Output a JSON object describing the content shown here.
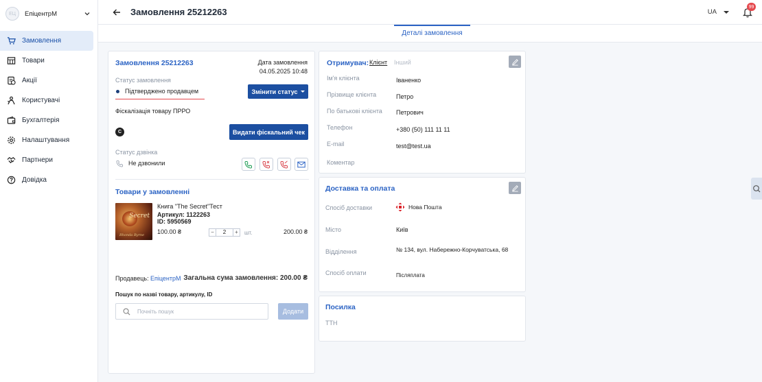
{
  "sidebar": {
    "logo_text": "ЕЦ",
    "company": "ЕпіцентрМ",
    "items": [
      {
        "label": "Замовлення",
        "active": true
      },
      {
        "label": "Товари"
      },
      {
        "label": "Акції"
      },
      {
        "label": "Користувачі"
      },
      {
        "label": "Бухгалтерія"
      },
      {
        "label": "Налаштування"
      },
      {
        "label": "Партнери"
      },
      {
        "label": "Довідка"
      }
    ]
  },
  "header": {
    "title": "Замовлення 25212263",
    "lang": "UA",
    "notifications": "99"
  },
  "tabs": [
    {
      "label": "Деталі замовлення",
      "active": true
    }
  ],
  "order": {
    "title": "Замовлення 25212263",
    "date_label": "Дата замовлення",
    "date_value": "04.05.2025 10:48",
    "status_label": "Статус замовлення",
    "status_value": "Підтверджено продавцем",
    "change_status": "Змінити статус",
    "fiscal_label": "Фіскалізація товару ПРРО",
    "fiscal_badge": "C",
    "fiscal_button": "Видати фіскальний чек",
    "call_status_label": "Статус дзвінка",
    "call_status_value": "Не дзвонили",
    "items_title": "Товари у замовленні",
    "item": {
      "cover_title": "Secret",
      "cover_author": "Rhonda Byrne",
      "name": "Книга \"The Secret\"Тест",
      "sku": "Артикул: 1122263",
      "id": "ID: 5950569",
      "price": "100.00 ₴",
      "qty": "2",
      "unit": "шт.",
      "total": "200.00 ₴"
    },
    "seller_label": "Продавець:",
    "seller_value": "ЕпіцентрМ",
    "sum_label": "Загальна сума замовлення: 200.00 ₴",
    "search_label": "Пошук по назві товару, артикулу, ID",
    "search_placeholder": "Почніть пошук",
    "add_button": "Додати"
  },
  "receiver": {
    "title": "Отримувач:",
    "tab_client": "Клієнт",
    "tab_other": "Інший",
    "fields": [
      {
        "label": "Ім'я клієнта",
        "value": "Іваненко"
      },
      {
        "label": "Прізвище клієнта",
        "value": "Петро"
      },
      {
        "label": "По батькові клієнта",
        "value": "Петрович"
      },
      {
        "label": "Телефон",
        "value": "+380 (50) 111 11 11"
      },
      {
        "label": "E-mail",
        "value": "test@test.ua"
      },
      {
        "label": "Коментар",
        "value": ""
      }
    ]
  },
  "delivery": {
    "title": "Доставка та оплата",
    "fields": [
      {
        "label": "Спосіб доставки",
        "value": "Нова Пошта"
      },
      {
        "label": "Місто",
        "value": "Київ"
      },
      {
        "label": "Відділення",
        "value": "№ 134, вул. Набережно-Корчуватська, 68"
      },
      {
        "label": "Спосіб оплати",
        "value": "Післяплата"
      }
    ]
  },
  "parcel": {
    "title": "Посилка",
    "ttn_label": "ТТН"
  }
}
